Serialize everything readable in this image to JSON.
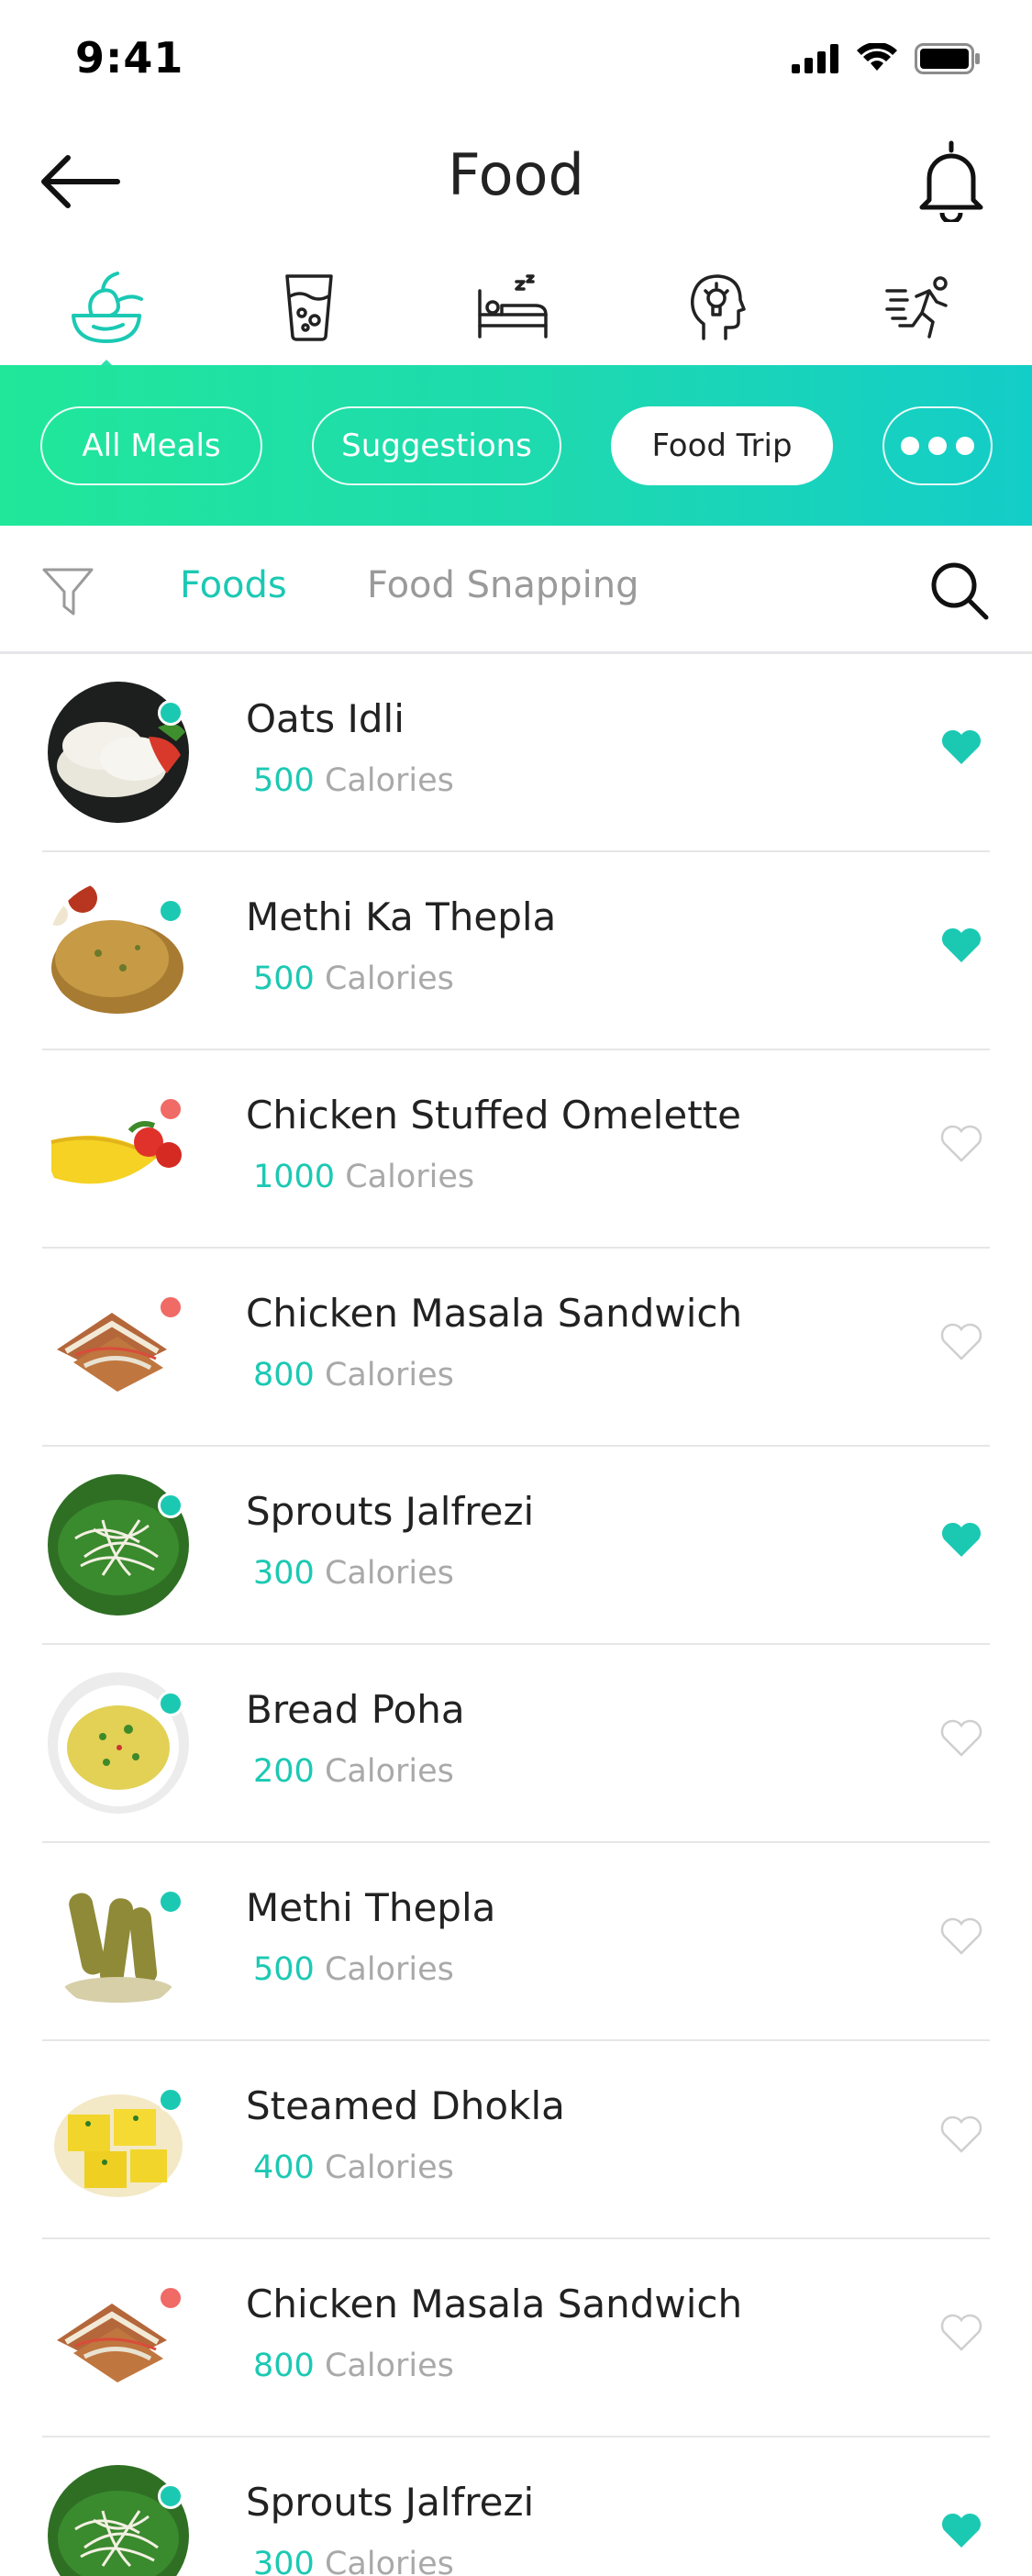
{
  "status_bar": {
    "time": "9:41"
  },
  "header": {
    "title": "Food"
  },
  "categories": [
    {
      "icon": "food-icon",
      "active": true
    },
    {
      "icon": "water-glass-icon",
      "active": false
    },
    {
      "icon": "sleep-icon",
      "active": false
    },
    {
      "icon": "mind-icon",
      "active": false
    },
    {
      "icon": "running-icon",
      "active": false
    }
  ],
  "filters": {
    "all_meals": "All Meals",
    "suggestions": "Suggestions",
    "food_trip": "Food Trip",
    "selected": "Food Trip"
  },
  "tabs": {
    "foods": "Foods",
    "food_snapping": "Food Snapping",
    "selected": "Foods"
  },
  "calories_unit": "Calories",
  "foods": [
    {
      "name": "Oats Idli",
      "calories": "500",
      "favorite": true,
      "type": "veg",
      "image": "idli"
    },
    {
      "name": "Methi Ka Thepla",
      "calories": "500",
      "favorite": true,
      "type": "veg",
      "image": "thepla"
    },
    {
      "name": "Chicken Stuffed Omelette",
      "calories": "1000",
      "favorite": false,
      "type": "nonveg",
      "image": "omelette"
    },
    {
      "name": "Chicken Masala Sandwich",
      "calories": "800",
      "favorite": false,
      "type": "nonveg",
      "image": "sandwich"
    },
    {
      "name": "Sprouts Jalfrezi",
      "calories": "300",
      "favorite": true,
      "type": "veg",
      "image": "sprouts"
    },
    {
      "name": "Bread Poha",
      "calories": "200",
      "favorite": false,
      "type": "veg",
      "image": "poha"
    },
    {
      "name": "Methi Thepla",
      "calories": "500",
      "favorite": false,
      "type": "veg",
      "image": "rolls"
    },
    {
      "name": "Steamed Dhokla",
      "calories": "400",
      "favorite": false,
      "type": "veg",
      "image": "dhokla"
    },
    {
      "name": "Chicken Masala Sandwich",
      "calories": "800",
      "favorite": false,
      "type": "nonveg",
      "image": "sandwich"
    },
    {
      "name": "Sprouts Jalfrezi",
      "calories": "300",
      "favorite": true,
      "type": "veg",
      "image": "sprouts"
    }
  ],
  "colors": {
    "accent": "#1bc9b3",
    "veg": "#1bc9b3",
    "nonveg": "#f06a66",
    "gradient_start": "#20e79a",
    "gradient_end": "#13cdc8"
  }
}
